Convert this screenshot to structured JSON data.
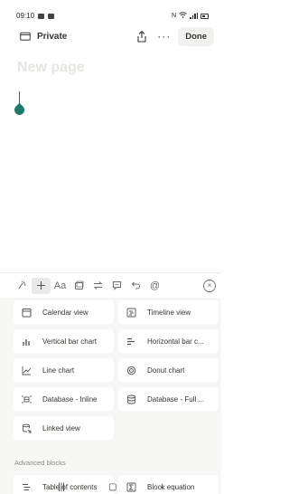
{
  "status_bar": {
    "time": "09:10"
  },
  "topbar": {
    "page_path": "Private",
    "more_label": "···",
    "done_label": "Done"
  },
  "editor": {
    "title_placeholder": "New page"
  },
  "toolbar": {
    "text_style_label": "Aa"
  },
  "blocks": [
    {
      "label": "Calendar view",
      "icon": "calendar-icon"
    },
    {
      "label": "Timeline view",
      "icon": "timeline-icon"
    },
    {
      "label": "Vertical bar chart",
      "icon": "vertical-bar-chart-icon"
    },
    {
      "label": "Horizontal bar c...",
      "icon": "horizontal-bar-chart-icon"
    },
    {
      "label": "Line chart",
      "icon": "line-chart-icon"
    },
    {
      "label": "Donut chart",
      "icon": "donut-chart-icon"
    },
    {
      "label": "Database - Inline",
      "icon": "database-inline-icon"
    },
    {
      "label": "Database - Full ...",
      "icon": "database-full-icon"
    },
    {
      "label": "Linked view",
      "icon": "linked-view-icon"
    }
  ],
  "advanced": {
    "header": "Advanced blocks",
    "items": [
      {
        "label": "Table of contents",
        "icon": "table-of-contents-icon"
      },
      {
        "label": "Block equation",
        "icon": "block-equation-icon"
      }
    ]
  }
}
